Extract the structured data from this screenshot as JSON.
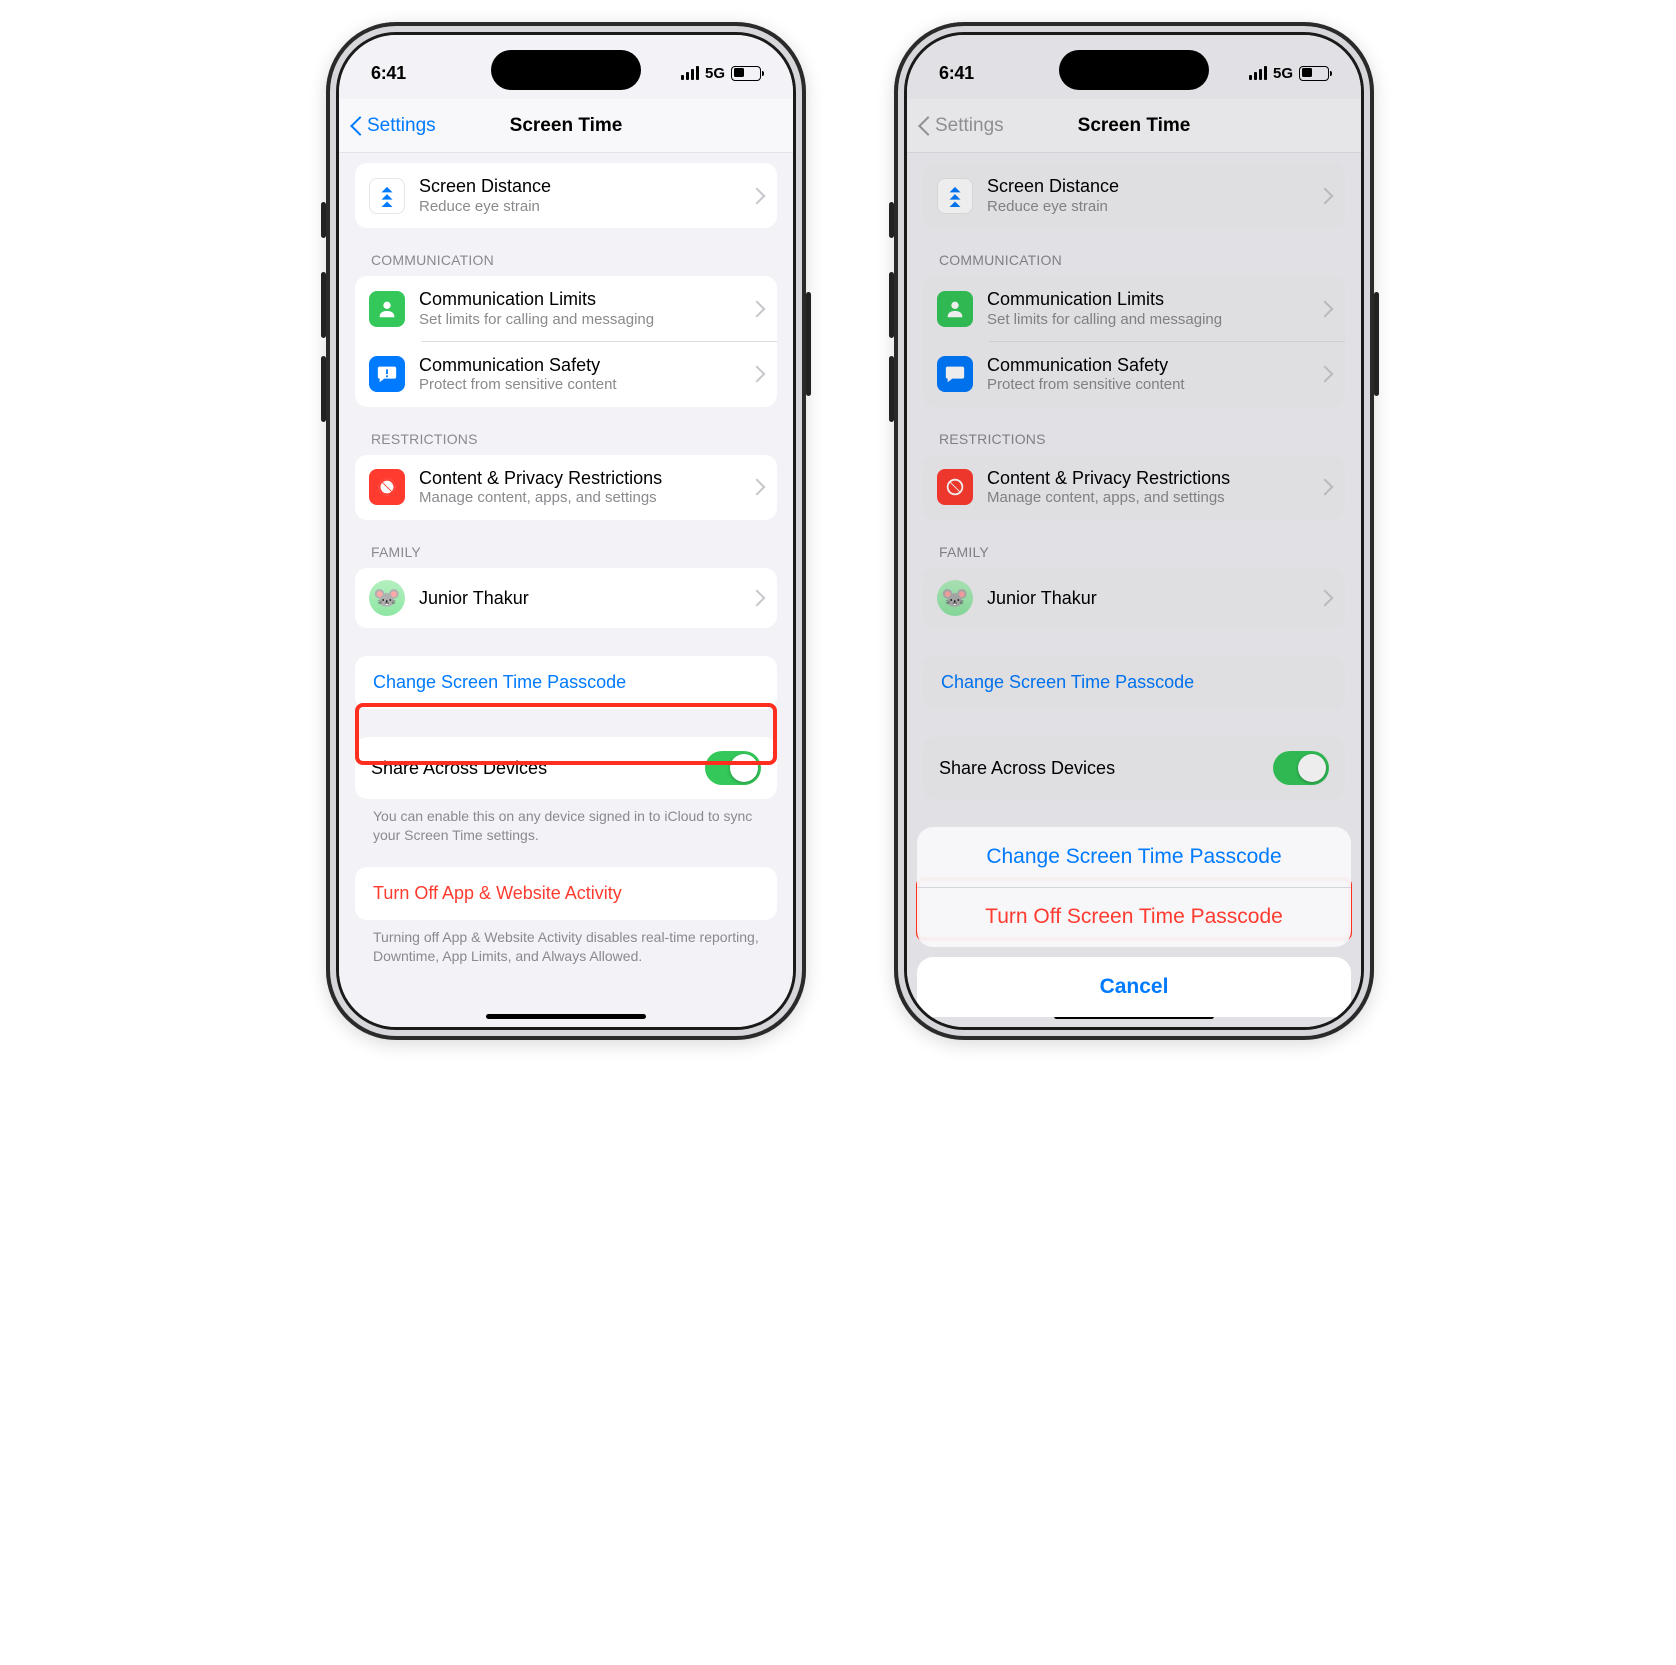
{
  "status": {
    "time": "6:41",
    "network": "5G"
  },
  "nav": {
    "back": "Settings",
    "title": "Screen Time"
  },
  "rows": {
    "screen_distance": {
      "title": "Screen Distance",
      "sub": "Reduce eye strain"
    },
    "comm_limits": {
      "title": "Communication Limits",
      "sub": "Set limits for calling and messaging"
    },
    "comm_safety": {
      "title": "Communication Safety",
      "sub": "Protect from sensitive content"
    },
    "restrictions": {
      "title": "Content & Privacy Restrictions",
      "sub": "Manage content, apps, and settings"
    },
    "family_member": {
      "title": "Junior Thakur"
    }
  },
  "headers": {
    "communication": "COMMUNICATION",
    "restrictions": "RESTRICTIONS",
    "family": "FAMILY"
  },
  "change_passcode": "Change Screen Time Passcode",
  "share_across": "Share Across Devices",
  "share_foot": "You can enable this on any device signed in to iCloud to sync your Screen Time settings.",
  "turn_off_activity": "Turn Off App & Website Activity",
  "turn_off_foot": "Turning off App & Website Activity disables real-time reporting, Downtime, App Limits, and Always Allowed.",
  "sheet": {
    "change": "Change Screen Time Passcode",
    "turn_off": "Turn Off Screen Time Passcode",
    "cancel": "Cancel"
  }
}
